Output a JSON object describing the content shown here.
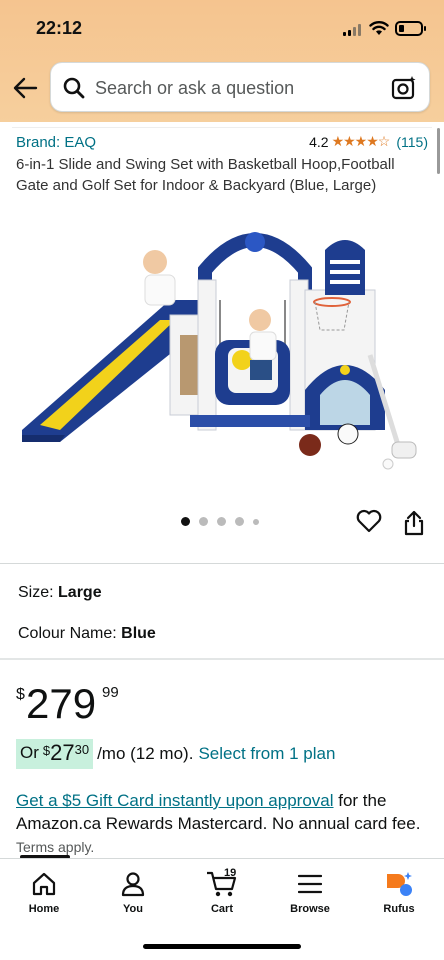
{
  "status_bar": {
    "time": "22:12"
  },
  "search": {
    "placeholder": "Search or ask a question"
  },
  "product": {
    "brand": "Brand: EAQ",
    "rating": "4.2",
    "stars": "★★★★☆",
    "review_count": "(115)",
    "title": "6-in-1 Slide and Swing Set with Basketball Hoop,Football Gate and Golf Set for Indoor & Backyard (Blue, Large)",
    "image_index": 1,
    "image_count": 5
  },
  "options": {
    "size_label": "Size:",
    "size_value": "Large",
    "colour_label": "Colour Name:",
    "colour_value": "Blue"
  },
  "price": {
    "currency": "$",
    "whole": "279",
    "fraction": "99"
  },
  "installment": {
    "prefix": "Or",
    "currency": "$",
    "whole": "27",
    "fraction": "30",
    "term": "/mo (12 mo).",
    "plan_link": "Select from 1 plan"
  },
  "promo": {
    "link": "Get a $5 Gift Card instantly upon approval",
    "text": " for the Amazon.ca Rewards Mastercard. No annual card fee.",
    "terms": "Terms apply."
  },
  "tabs": [
    {
      "label": "Home",
      "icon": "home-icon"
    },
    {
      "label": "You",
      "icon": "person-icon"
    },
    {
      "label": "Cart",
      "icon": "cart-icon",
      "count": "19"
    },
    {
      "label": "Browse",
      "icon": "menu-icon"
    },
    {
      "label": "Rufus",
      "icon": "rufus-icon"
    }
  ],
  "colors": {
    "header": "#f5c48f",
    "link": "#007185",
    "star": "#de7921",
    "highlight": "#c8f0dd"
  }
}
